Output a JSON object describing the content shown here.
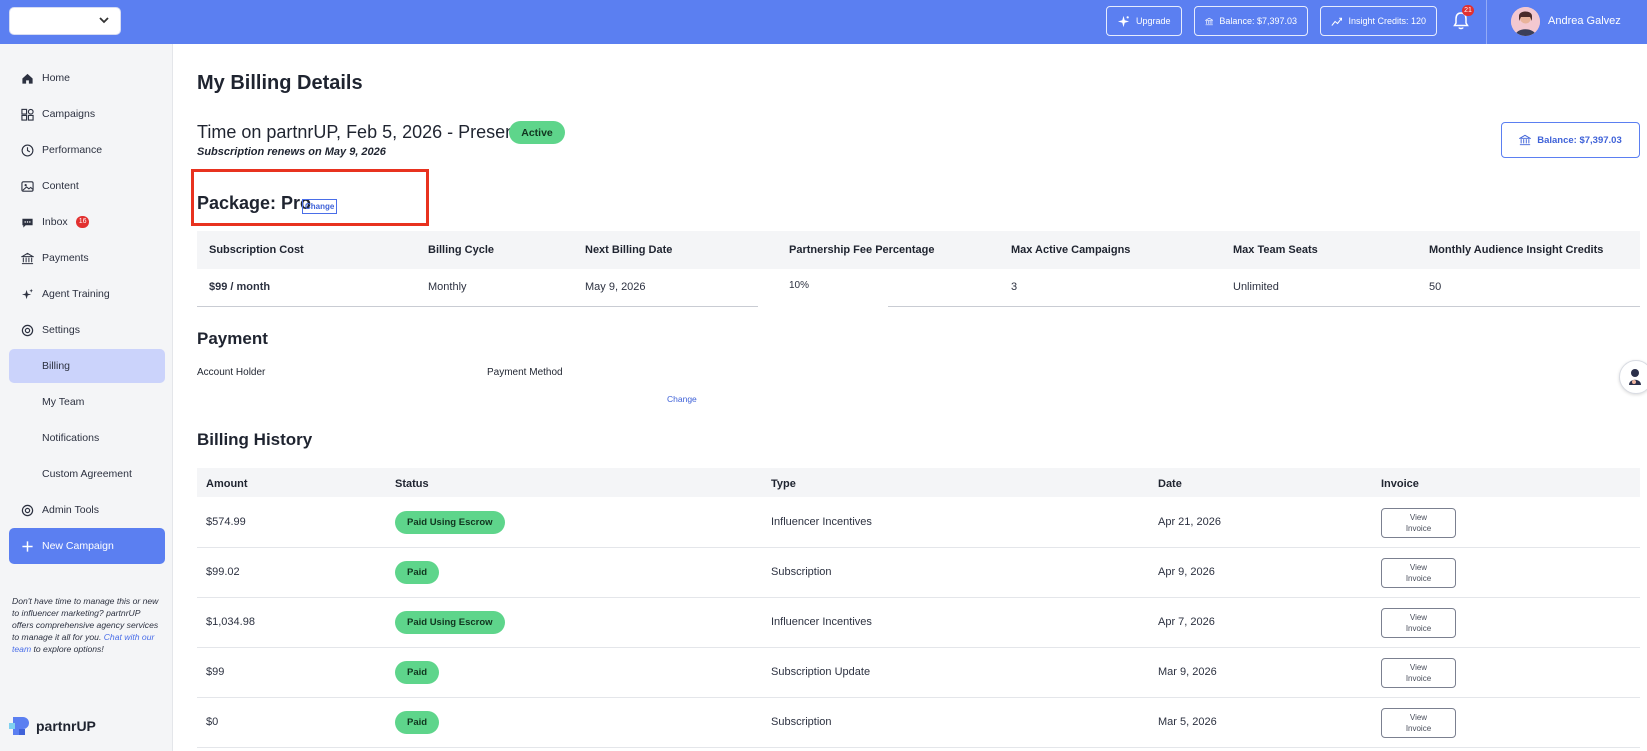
{
  "topbar": {
    "org_select_value": "",
    "upgrade_label": "Upgrade",
    "balance_label": "Balance: $7,397.03",
    "insight_credits_label": "Insight Credits: 120",
    "notification_count": "21",
    "user_name": "Andrea Galvez"
  },
  "sidebar": {
    "items": [
      {
        "label": "Home",
        "icon": "home-icon"
      },
      {
        "label": "Campaigns",
        "icon": "campaigns-icon"
      },
      {
        "label": "Performance",
        "icon": "performance-icon"
      },
      {
        "label": "Content",
        "icon": "content-icon"
      },
      {
        "label": "Inbox",
        "icon": "inbox-icon",
        "badge": "16"
      },
      {
        "label": "Payments",
        "icon": "payments-icon"
      },
      {
        "label": "Agent Training",
        "icon": "sparkle-icon"
      },
      {
        "label": "Settings",
        "icon": "gear-icon"
      }
    ],
    "settings_sub": [
      {
        "label": "Billing",
        "active": true
      },
      {
        "label": "My Team"
      },
      {
        "label": "Notifications"
      },
      {
        "label": "Custom Agreement"
      }
    ],
    "admin_tools_label": "Admin Tools",
    "new_campaign_label": "New Campaign",
    "promo_text": "Don't have time to manage this or new to influencer marketing? partnrUP offers comprehensive agency services to manage it all for you.",
    "promo_link": "Chat with our team",
    "promo_suffix": "to explore options!",
    "logo_text": "partnrUP"
  },
  "main": {
    "title": "My Billing Details",
    "time_on": "Time on partnrUP, Feb 5, 2026 - Present",
    "status": "Active",
    "renews": "Subscription renews on May 9, 2026",
    "balance_button": "Balance: $7,397.03",
    "package": "Package: Pro",
    "package_change": "Change",
    "subscription_table": {
      "headers": [
        "Subscription Cost",
        "Billing Cycle",
        "Next Billing Date",
        "Partnership Fee Percentage",
        "Max Active Campaigns",
        "Max Team Seats",
        "Monthly Audience Insight Credits"
      ],
      "row": [
        "$99 / month",
        "Monthly",
        "May 9, 2026",
        "10%",
        "3",
        "Unlimited",
        "50"
      ]
    },
    "payment": {
      "title": "Payment",
      "account_holder_label": "Account Holder",
      "payment_method_label": "Payment Method",
      "change_label": "Change"
    },
    "billing_history": {
      "title": "Billing History",
      "headers": [
        "Amount",
        "Status",
        "Type",
        "Date",
        "Invoice"
      ],
      "view_line1": "View",
      "view_line2": "Invoice",
      "rows": [
        {
          "amount": "$574.99",
          "status": "Paid Using Escrow",
          "type": "Influencer Incentives",
          "date": "Apr 21, 2026"
        },
        {
          "amount": "$99.02",
          "status": "Paid",
          "type": "Subscription",
          "date": "Apr 9, 2026"
        },
        {
          "amount": "$1,034.98",
          "status": "Paid Using Escrow",
          "type": "Influencer Incentives",
          "date": "Apr 7, 2026"
        },
        {
          "amount": "$99",
          "status": "Paid",
          "type": "Subscription Update",
          "date": "Mar 9, 2026"
        },
        {
          "amount": "$0",
          "status": "Paid",
          "type": "Subscription",
          "date": "Mar 5, 2026"
        }
      ]
    }
  },
  "colors": {
    "brand": "#5b7ff1",
    "status_green": "#5ed58b",
    "highlight_red": "#e8321f",
    "badge_red": "#e23030"
  }
}
